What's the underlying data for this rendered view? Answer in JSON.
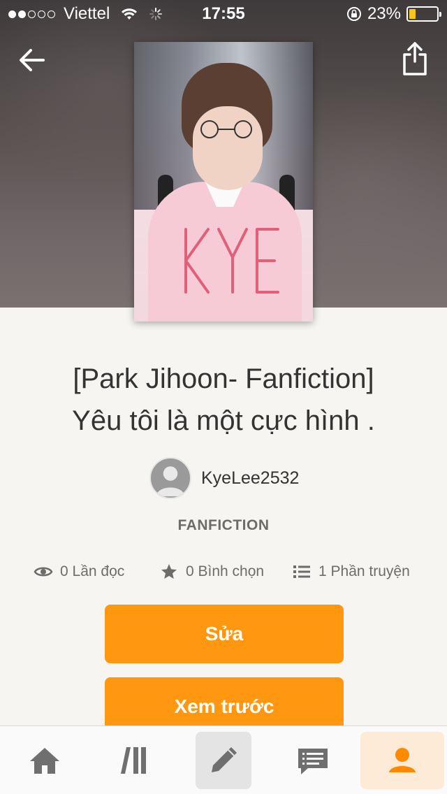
{
  "status_bar": {
    "carrier": "Viettel",
    "time": "17:55",
    "battery": "23%",
    "signal_strength": 2,
    "signal_total": 5,
    "battery_level_fraction": 0.23
  },
  "header": {
    "back_icon": "arrow-left-icon",
    "share_icon": "share-icon"
  },
  "story": {
    "title_line1": "[Park Jihoon- Fanfiction]",
    "title_line2": "Yêu tôi là một cực hình .",
    "author": "KyeLee2532",
    "category": "FANFICTION",
    "reads": "0 Lần đọc",
    "votes": "0 Bình chọn",
    "parts": "1 Phần truyện"
  },
  "actions": {
    "edit_label": "Sửa",
    "preview_label": "Xem trước"
  },
  "tabs": [
    {
      "name": "home",
      "icon": "home-icon"
    },
    {
      "name": "library",
      "icon": "library-icon"
    },
    {
      "name": "write",
      "icon": "pencil-icon",
      "active_bg": true
    },
    {
      "name": "messages",
      "icon": "chat-icon"
    },
    {
      "name": "profile",
      "icon": "person-icon",
      "selected": true
    }
  ],
  "colors": {
    "accent": "#ff9810",
    "background": "#f6f5f1",
    "text": "#333333",
    "muted": "#6c6c6c"
  }
}
